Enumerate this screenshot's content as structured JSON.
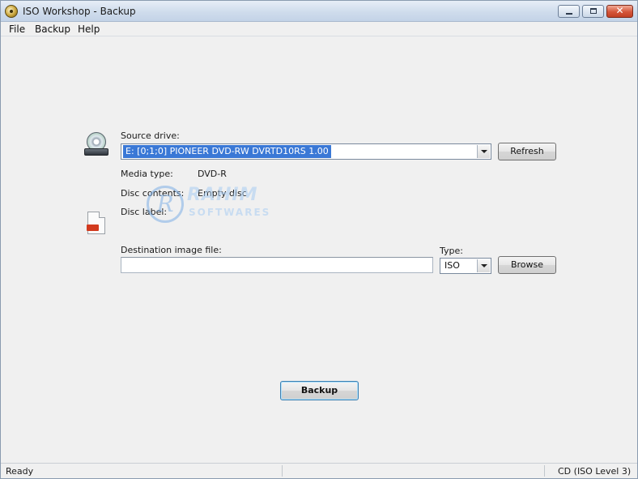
{
  "window": {
    "title": "ISO Workshop - Backup"
  },
  "menu": {
    "items": [
      "File",
      "Backup",
      "Help"
    ]
  },
  "source": {
    "label": "Source drive:",
    "selected_drive": "E:  [0;1;0] PIONEER DVD-RW DVRTD10RS 1.00",
    "refresh_label": "Refresh",
    "media_type_label": "Media type:",
    "media_type_value": "DVD-R",
    "disc_contents_label": "Disc contents:",
    "disc_contents_value": "Empty disc",
    "disc_label_label": "Disc label:",
    "disc_label_value": ""
  },
  "destination": {
    "label": "Destination image file:",
    "path_value": "",
    "type_label": "Type:",
    "type_value": "ISO",
    "browse_label": "Browse"
  },
  "actions": {
    "backup_label": "Backup"
  },
  "watermark": {
    "letter": "R",
    "line1": "RAHIM",
    "line2": "SOFTWARES"
  },
  "status": {
    "left": "Ready",
    "right": "CD (ISO Level 3)"
  },
  "colors": {
    "selection": "#3a78d6",
    "titlebar": "#cfdcec",
    "close_button": "#d4553a"
  }
}
